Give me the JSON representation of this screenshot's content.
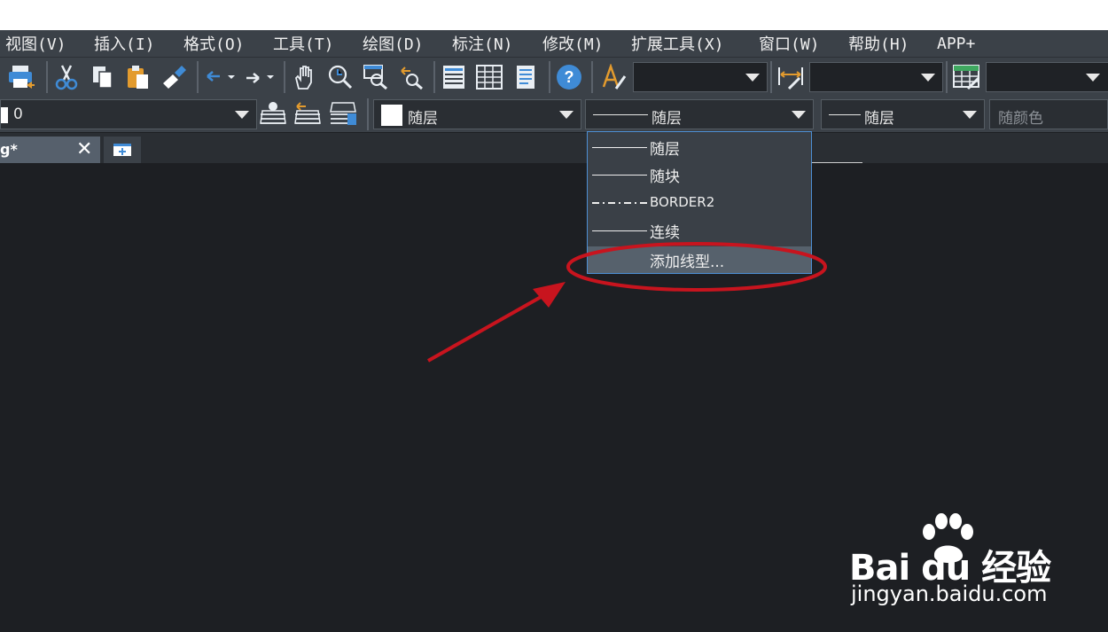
{
  "menu": [
    "视图(V)",
    "插入(I)",
    "格式(O)",
    "工具(T)",
    "绘图(D)",
    "标注(N)",
    "修改(M)",
    "扩展工具(X)",
    "窗口(W)",
    "帮助(H)",
    "APP+"
  ],
  "toolbar2": {
    "layer_value": "0",
    "color_value": "随层",
    "linetype_value": "随层",
    "lineweight_value": "随层",
    "plotstyle_placeholder": "随颜色"
  },
  "doc_tab": {
    "label": "g*",
    "close": "✕"
  },
  "linetype_dropdown": {
    "items": [
      {
        "label": "随层",
        "style": "solid"
      },
      {
        "label": "随块",
        "style": "solid"
      },
      {
        "label": "BORDER2",
        "style": "dashdot"
      },
      {
        "label": "连续",
        "style": "solid"
      },
      {
        "label": "添加线型...",
        "style": "none",
        "highlighted": true
      }
    ]
  },
  "annotation": {
    "color": "#c8141e"
  },
  "watermark": {
    "brand": "Bai du 经验",
    "url": "jingyan.baidu.com"
  },
  "colors": {
    "menu_bg": "#3b4148",
    "canvas_bg": "#1d1f23",
    "dropdown_border": "#4d8fd4",
    "accent_blue": "#3f8bd6"
  }
}
